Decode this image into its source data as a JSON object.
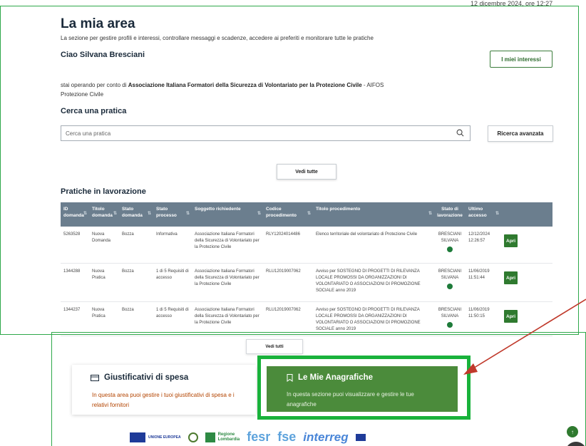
{
  "header": {
    "datetime": "12 dicembre 2024, ore 12:27",
    "title": "La mia area",
    "subtitle": "La sezione per gestire profili e interessi, controllare messaggi e scadenze, accedere ai preferiti e monitorare tutte le pratiche",
    "greeting": "Ciao Silvana Bresciani",
    "interests_button": "I miei interessi",
    "operating_prefix": "stai operando per conto di ",
    "operating_org": "Associazione Italiana Formatori della Sicurezza di Volontariato per la Protezione Civile",
    "operating_suffix": " - AIFOS Protezione Civile"
  },
  "search": {
    "title": "Cerca una pratica",
    "placeholder": "Cerca una pratica",
    "advanced_button": "Ricerca avanzata",
    "see_all_button": "Vedi tutte"
  },
  "table": {
    "title": "Pratiche in lavorazione",
    "columns": [
      "ID domanda",
      "Titolo domanda",
      "Stato domanda",
      "Stato processo",
      "Soggetto richiedente",
      "Codice procedimento",
      "Titolo procedimento",
      "Stato di lavorazione",
      "Ultimo accesso",
      ""
    ],
    "rows": [
      {
        "id": "5263528",
        "titolo": "Nuova Domanda",
        "stato": "Bozza",
        "processo": "Informativa",
        "soggetto": "Associazione Italiana Formatori della Sicurezza di Volontariato per la Protezione Civile",
        "codice": "RLY12024014486",
        "procedimento": "Elenco territoriale del volontariato di Protezione Civile",
        "lavorazione": "BRESCIANI SILVANA",
        "accesso": "12/12/2024 12:26:57",
        "action": "Apri"
      },
      {
        "id": "1344288",
        "titolo": "Nuova Pratica",
        "stato": "Bozza",
        "processo": "1 di 5 Requisiti di accesso",
        "soggetto": "Associazione Italiana Formatori della Sicurezza di Volontariato per la Protezione Civile",
        "codice": "RLU12019007062",
        "procedimento": "Avviso per SOSTEGNO DI PROGETTI DI RILEVANZA LOCALE PROMOSSI DA ORGANIZZAZIONI DI VOLONTARIATO O ASSOCIAZIONI DI PROMOZIONE SOCIALE anno 2019",
        "lavorazione": "BRESCIANI SILVANA",
        "accesso": "11/06/2019 11:51:44",
        "action": "Apri"
      },
      {
        "id": "1344237",
        "titolo": "Nuova Pratica",
        "stato": "Bozza",
        "processo": "1 di 5 Requisiti di accesso",
        "soggetto": "Associazione Italiana Formatori della Sicurezza di Volontariato per la Protezione Civile",
        "codice": "RLU12019007062",
        "procedimento": "Avviso per SOSTEGNO DI PROGETTI DI RILEVANZA LOCALE PROMOSSI DA ORGANIZZAZIONI DI VOLONTARIATO O ASSOCIAZIONI DI PROMOZIONE SOCIALE anno 2019",
        "lavorazione": "BRESCIANI SILVANA",
        "accesso": "11/06/2019 11:50:15",
        "action": "Apri"
      }
    ],
    "see_all_button": "Vedi tutti"
  },
  "cards": {
    "expenses_title": "Giustificativi di spesa",
    "expenses_desc": "In questa area puoi gestire i tuoi giustificativi di spesa e i relativi fornitori",
    "registry_title": "Le Mie Anagrafiche",
    "registry_desc": "In questa sezione puoi visualizzare e gestire le tue anagrafiche"
  },
  "footer": {
    "eu_label": "UNIONE EUROPEA",
    "lombardia_label_1": "Regione",
    "lombardia_label_2": "Lombardia",
    "fesr": "fesr",
    "fse": "fse",
    "interreg": "interreg"
  },
  "colors": {
    "accent_green": "#2f7a2f",
    "highlight_green": "#19b23b",
    "table_header": "#6b7e8e",
    "annotation_arrow": "#c0392b"
  }
}
